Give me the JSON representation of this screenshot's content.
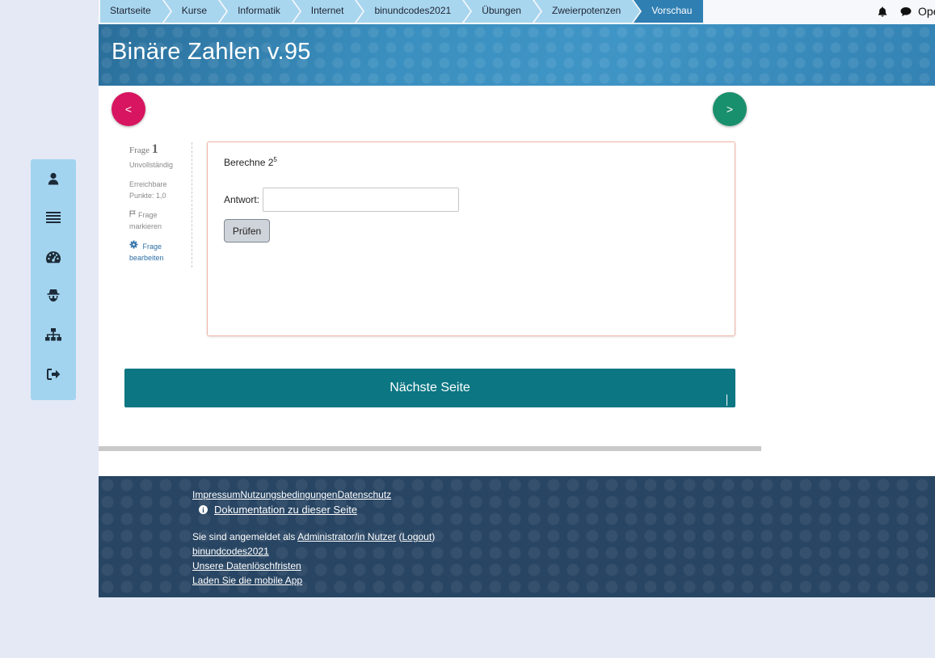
{
  "breadcrumbs": [
    {
      "label": "Startseite"
    },
    {
      "label": "Kurse"
    },
    {
      "label": "Informatik"
    },
    {
      "label": "Internet"
    },
    {
      "label": "binundcodes2021"
    },
    {
      "label": "Übungen"
    },
    {
      "label": "Zweierpotenzen"
    },
    {
      "label": "Vorschau"
    }
  ],
  "topbar": {
    "partial_label": "Ope"
  },
  "page_title": "Binäre Zahlen v.95",
  "nav": {
    "prev_label": "<",
    "next_label": ">"
  },
  "question_info": {
    "frage_label": "Frage",
    "frage_number": "1",
    "status": "Unvollständig",
    "points_line1": "Erreichbare",
    "points_line2": "Punkte: 1,0",
    "flag_line1": "Frage",
    "flag_line2": "markieren",
    "edit_line1": "Frage",
    "edit_line2": "bearbeiten"
  },
  "question": {
    "text_base": "Berechne 2",
    "text_exp": "5",
    "answer_label": "Antwort:",
    "answer_value": "",
    "check_button": "Prüfen"
  },
  "next_page_button": "Nächste Seite",
  "footer": {
    "links": [
      "Impressum",
      "Nutzungsbedingungen",
      "Datenschutz"
    ],
    "doc_link": "Dokumentation zu dieser Seite",
    "login_prefix": "Sie sind angemeldet als ",
    "login_user": "Administrator/in Nutzer",
    "login_open": " (",
    "logout": "Logout",
    "login_close": ")",
    "course_link": "binundcodes2021",
    "retention_link": "Unsere Datenlöschfristen",
    "app_link": "Laden Sie die mobile App"
  },
  "sidebar": {
    "icons": [
      "user-icon",
      "list-icon",
      "dashboard-icon",
      "spy-icon",
      "sitemap-icon",
      "logout-icon"
    ]
  },
  "colors": {
    "prev_button": "#d81560",
    "next_button": "#19906d",
    "next_page_button": "#0c7683",
    "breadcrumb_active": "#2f7fb3",
    "breadcrumb": "#a9d6ef",
    "sidebar": "#a3d4ef",
    "footer": "#284563"
  }
}
